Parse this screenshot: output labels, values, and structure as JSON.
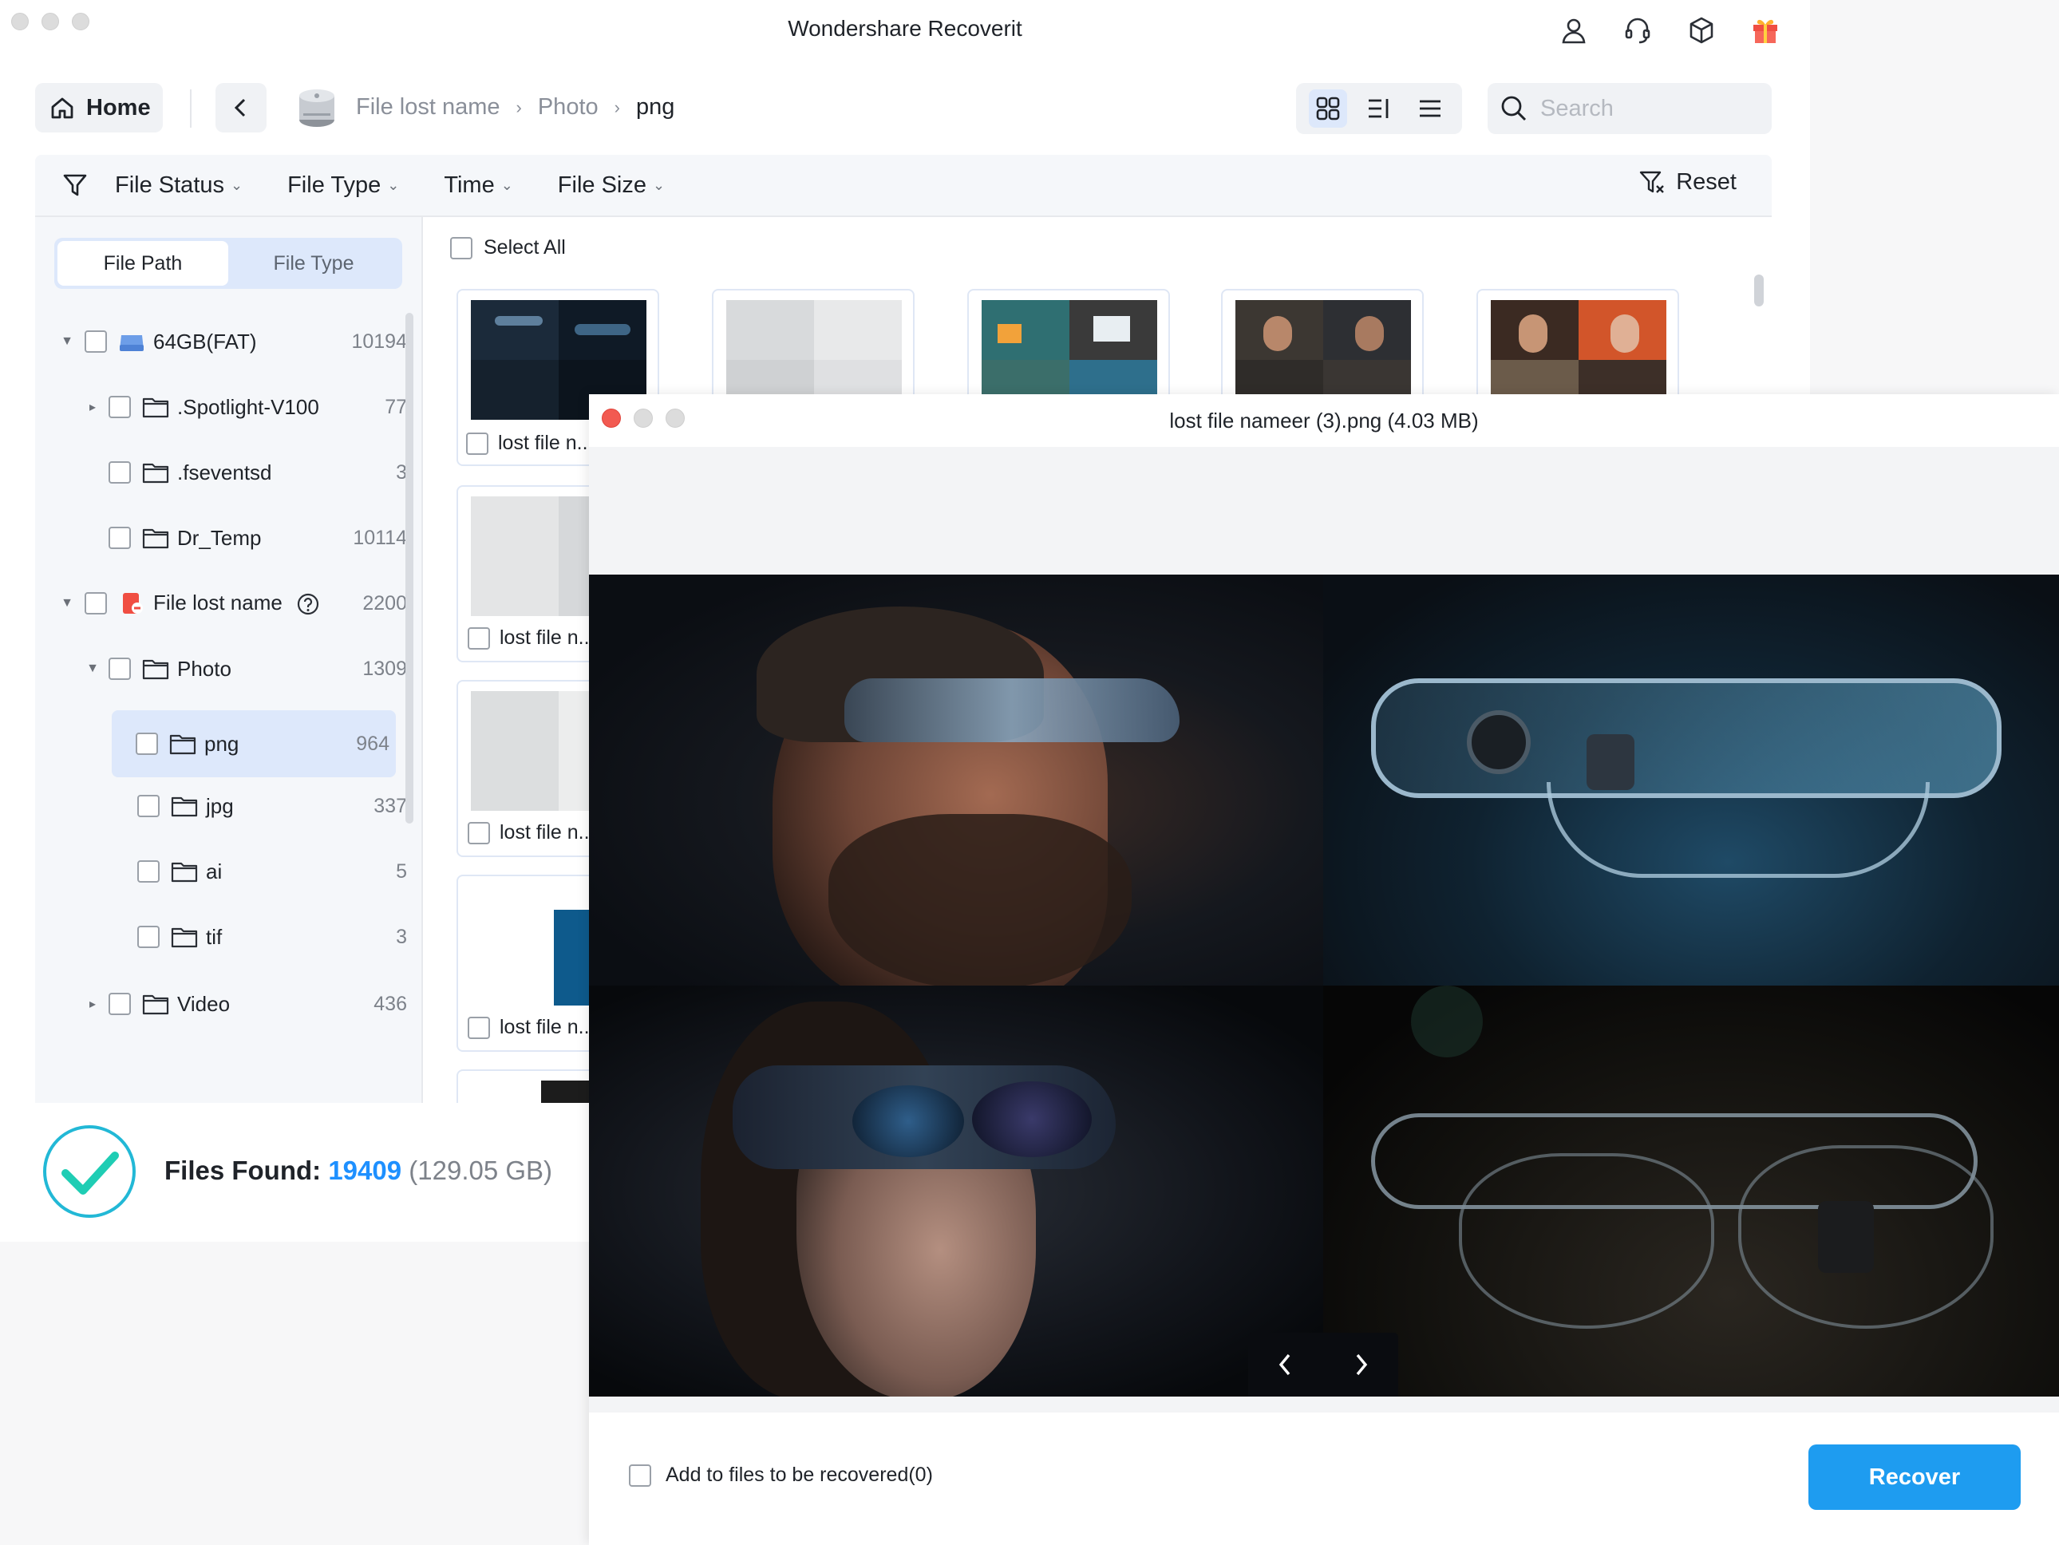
{
  "window": {
    "title": "Wondershare Recoverit"
  },
  "header_icons": [
    "user-icon",
    "headset-icon",
    "cube-icon",
    "gift-icon"
  ],
  "nav": {
    "home_label": "Home",
    "breadcrumb": [
      "File lost name",
      "Photo",
      "png"
    ]
  },
  "search": {
    "placeholder": "Search"
  },
  "filters": {
    "items": [
      "File Status",
      "File Type",
      "Time",
      "File Size"
    ],
    "reset_label": "Reset"
  },
  "sidebar": {
    "tabs": [
      "File Path",
      "File Type"
    ],
    "tree": [
      {
        "label": "64GB(FAT)",
        "count": "10194"
      },
      {
        "label": ".Spotlight-V100",
        "count": "77"
      },
      {
        "label": ".fseventsd",
        "count": "3"
      },
      {
        "label": "Dr_Temp",
        "count": "10114"
      },
      {
        "label": "File lost name",
        "count": "2200"
      },
      {
        "label": "Photo",
        "count": "1309"
      },
      {
        "label": "png",
        "count": "964"
      },
      {
        "label": "jpg",
        "count": "337"
      },
      {
        "label": "ai",
        "count": "5"
      },
      {
        "label": "tif",
        "count": "3"
      },
      {
        "label": "Video",
        "count": "436"
      }
    ]
  },
  "content": {
    "select_all": "Select All",
    "thumb_label": "lost file n..."
  },
  "status": {
    "label": "Files Found:",
    "count": "19409",
    "size": "(129.05 GB)"
  },
  "preview": {
    "title": "lost file nameer (3).png (4.03 MB)",
    "add_label": "Add to files to be recovered(0)",
    "recover_label": "Recover"
  },
  "colors": {
    "accent": "#1e9cf0",
    "count_blue": "#1e90ff",
    "selected_row": "#dde8fb",
    "close_red": "#f25a51"
  }
}
